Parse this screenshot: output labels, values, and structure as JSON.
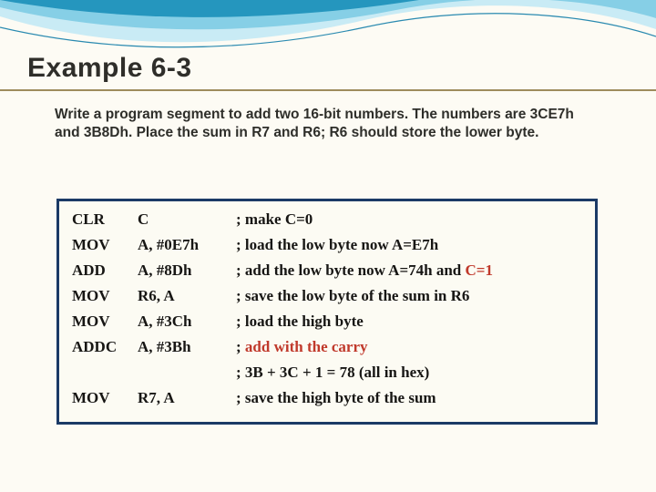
{
  "title": "Example 6-3",
  "description": "Write a program segment to add two 16-bit numbers. The numbers are 3CE7h and 3B8Dh. Place the sum in R7 and R6; R6 should store the lower byte.",
  "code": {
    "r0": {
      "mn": "CLR",
      "op": "C",
      "cm": "; make C=0"
    },
    "r1": {
      "mn": "MOV",
      "op": "A, #0E7h",
      "cm": "; load the low byte now A=E7h"
    },
    "r2": {
      "mn": "ADD",
      "op": "A, #8Dh",
      "cm_pre": "; add the low byte now A=74h and ",
      "cm_hi": "C=1"
    },
    "r3": {
      "mn": "MOV",
      "op": "R6, A",
      "cm": "; save the low byte of the sum in R6"
    },
    "r4": {
      "mn": "MOV",
      "op": "A, #3Ch",
      "cm": "; load the high byte"
    },
    "r5": {
      "mn": "ADDC",
      "op": "A, #3Bh",
      "cm_pre": "; ",
      "cm_hi": "add with the carry"
    },
    "note": "; 3B + 3C + 1 = 78 (all in hex)",
    "r6": {
      "mn": "MOV",
      "op": "R7, A",
      "cm": "; save the high byte of the sum"
    }
  }
}
